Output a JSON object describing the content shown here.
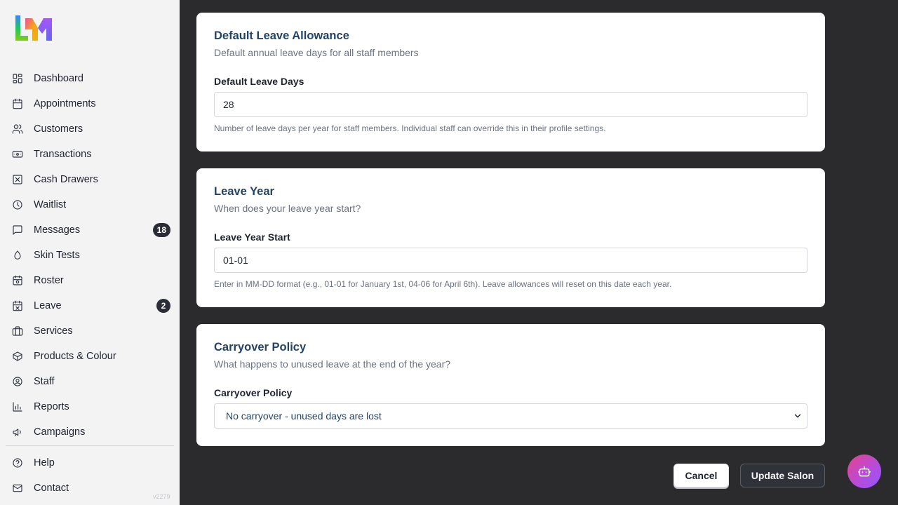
{
  "sidebar": {
    "items": [
      {
        "label": "Dashboard",
        "icon": "dashboard-icon"
      },
      {
        "label": "Appointments",
        "icon": "calendar-icon"
      },
      {
        "label": "Customers",
        "icon": "users-icon"
      },
      {
        "label": "Transactions",
        "icon": "banknote-icon"
      },
      {
        "label": "Cash Drawers",
        "icon": "cash-drawer-icon"
      },
      {
        "label": "Waitlist",
        "icon": "clock-icon"
      },
      {
        "label": "Messages",
        "icon": "message-icon",
        "badge": "18"
      },
      {
        "label": "Skin Tests",
        "icon": "droplet-icon"
      },
      {
        "label": "Roster",
        "icon": "roster-icon"
      },
      {
        "label": "Leave",
        "icon": "calendar-off-icon",
        "badge": "2"
      },
      {
        "label": "Services",
        "icon": "briefcase-icon"
      },
      {
        "label": "Products & Colour",
        "icon": "package-icon"
      },
      {
        "label": "Staff",
        "icon": "user-circle-icon"
      },
      {
        "label": "Reports",
        "icon": "bar-chart-icon"
      },
      {
        "label": "Campaigns",
        "icon": "megaphone-icon"
      }
    ],
    "bottom_items": [
      {
        "label": "Help",
        "icon": "help-circle-icon"
      },
      {
        "label": "Contact",
        "icon": "mail-icon"
      }
    ],
    "version": "v2279"
  },
  "sections": {
    "allowance": {
      "title": "Default Leave Allowance",
      "description": "Default annual leave days for all staff members",
      "field_label": "Default Leave Days",
      "value": "28",
      "help": "Number of leave days per year for staff members. Individual staff can override this in their profile settings."
    },
    "leave_year": {
      "title": "Leave Year",
      "description": "When does your leave year start?",
      "field_label": "Leave Year Start",
      "value": "01-01",
      "help": "Enter in MM-DD format (e.g., 01-01 for January 1st, 04-06 for April 6th). Leave allowances will reset on this date each year."
    },
    "carryover": {
      "title": "Carryover Policy",
      "description": "What happens to unused leave at the end of the year?",
      "field_label": "Carryover Policy",
      "selected": "No carryover - unused days are lost"
    }
  },
  "actions": {
    "cancel_label": "Cancel",
    "update_label": "Update Salon"
  },
  "colors": {
    "background": "#2b2b2d",
    "sidebar": "#f3f3f4",
    "heading": "#234466",
    "primary_button": "#2f3238"
  }
}
